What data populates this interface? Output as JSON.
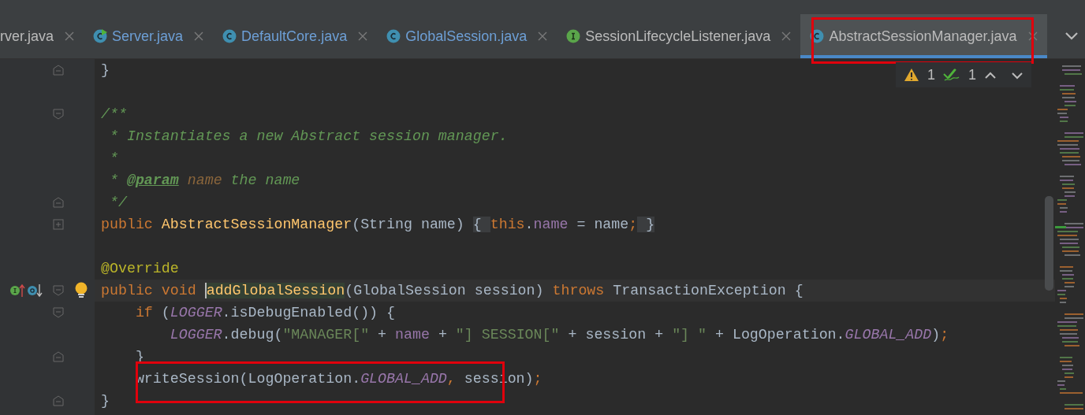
{
  "tabs": [
    {
      "label": "rver.java",
      "modified": false,
      "selected": false,
      "marked": false
    },
    {
      "label": "Server.java",
      "kind": "runnable-class",
      "modified": true,
      "selected": false,
      "marked": false
    },
    {
      "label": "DefaultCore.java",
      "kind": "class",
      "modified": true,
      "selected": false,
      "marked": false
    },
    {
      "label": "GlobalSession.java",
      "kind": "class",
      "modified": true,
      "selected": false,
      "marked": false
    },
    {
      "label": "SessionLifecycleListener.java",
      "kind": "interface",
      "modified": false,
      "selected": false,
      "marked": false
    },
    {
      "label": "AbstractSessionManager.java",
      "kind": "class",
      "modified": false,
      "selected": true,
      "marked": true
    }
  ],
  "inspections": {
    "warnings": "1",
    "weak_warnings": "1"
  },
  "lines": [
    {
      "gutter": [
        {
          "kind": "fold-end"
        }
      ],
      "tokens": [
        {
          "kind": "plain",
          "text": "}"
        }
      ]
    },
    {
      "kind": "blank"
    },
    {
      "gutter": [
        {
          "kind": "fold-start"
        }
      ],
      "tokens": [
        {
          "kind": "comment",
          "text": "/**"
        }
      ]
    },
    {
      "tokens": [
        {
          "kind": "comment",
          "text": " * Instantiates a new Abstract session manager."
        }
      ]
    },
    {
      "tokens": [
        {
          "kind": "comment",
          "text": " *"
        }
      ]
    },
    {
      "tokens": [
        {
          "kind": "comment",
          "text": " * "
        },
        {
          "kind": "doctag",
          "text": "@param"
        },
        {
          "kind": "docparam",
          "text": " name"
        },
        {
          "kind": "comment",
          "text": " the name"
        }
      ]
    },
    {
      "gutter": [
        {
          "kind": "fold-end"
        }
      ],
      "tokens": [
        {
          "kind": "comment",
          "text": " */"
        }
      ]
    },
    {
      "gutter": [
        {
          "kind": "fold-collapsed"
        }
      ],
      "tokens": [
        {
          "kind": "keyword",
          "text": "public "
        },
        {
          "kind": "decl",
          "text": "AbstractSessionManager"
        },
        {
          "kind": "plain",
          "text": "(String name) "
        },
        {
          "kind": "foldbox",
          "text": "{ "
        },
        {
          "kind": "keyword",
          "text": "this"
        },
        {
          "kind": "plain",
          "text": "."
        },
        {
          "kind": "field",
          "text": "name"
        },
        {
          "kind": "plain",
          "text": " = name"
        },
        {
          "kind": "keyword",
          "text": ";"
        },
        {
          "kind": "foldbox",
          "text": " }"
        }
      ]
    },
    {
      "kind": "blank"
    },
    {
      "tokens": [
        {
          "kind": "annotation",
          "text": "@Override"
        }
      ]
    },
    {
      "current": true,
      "gutter": [
        {
          "kind": "implements"
        },
        {
          "kind": "overridden"
        },
        {
          "kind": "fold-start"
        },
        {
          "kind": "bulb"
        }
      ],
      "tokens": [
        {
          "kind": "keyword",
          "text": "public void "
        },
        {
          "kind": "usage",
          "text": "addGlobalSession"
        },
        {
          "kind": "plain",
          "text": "(GlobalSession session) "
        },
        {
          "kind": "keyword",
          "text": "throws "
        },
        {
          "kind": "plain",
          "text": "TransactionException {"
        }
      ]
    },
    {
      "gutter": [
        {
          "kind": "fold-start"
        }
      ],
      "tokens": [
        {
          "kind": "keyword",
          "text": "    if "
        },
        {
          "kind": "plain",
          "text": "("
        },
        {
          "kind": "static",
          "text": "LOGGER"
        },
        {
          "kind": "plain",
          "text": ".isDebugEnabled()) {"
        }
      ]
    },
    {
      "tokens": [
        {
          "kind": "static",
          "text": "        LOGGER"
        },
        {
          "kind": "plain",
          "text": ".debug("
        },
        {
          "kind": "string",
          "text": "\"MANAGER[\""
        },
        {
          "kind": "plain",
          "text": " + "
        },
        {
          "kind": "field",
          "text": "name"
        },
        {
          "kind": "plain",
          "text": " + "
        },
        {
          "kind": "string",
          "text": "\"] SESSION[\""
        },
        {
          "kind": "plain",
          "text": " + session + "
        },
        {
          "kind": "string",
          "text": "\"] \""
        },
        {
          "kind": "plain",
          "text": " + LogOperation."
        },
        {
          "kind": "static",
          "text": "GLOBAL_ADD"
        },
        {
          "kind": "plain",
          "text": ")"
        },
        {
          "kind": "keyword",
          "text": ";"
        }
      ]
    },
    {
      "gutter": [
        {
          "kind": "fold-end"
        }
      ],
      "tokens": [
        {
          "kind": "plain",
          "text": "    }"
        }
      ]
    },
    {
      "marked": true,
      "tokens": [
        {
          "kind": "plain",
          "text": "    writeSession(LogOperation."
        },
        {
          "kind": "static",
          "text": "GLOBAL_ADD"
        },
        {
          "kind": "keyword",
          "text": ", "
        },
        {
          "kind": "plain",
          "text": "session)"
        },
        {
          "kind": "keyword",
          "text": ";"
        }
      ]
    },
    {
      "gutter": [
        {
          "kind": "fold-end"
        }
      ],
      "tokens": [
        {
          "kind": "plain",
          "text": "}"
        }
      ]
    }
  ]
}
